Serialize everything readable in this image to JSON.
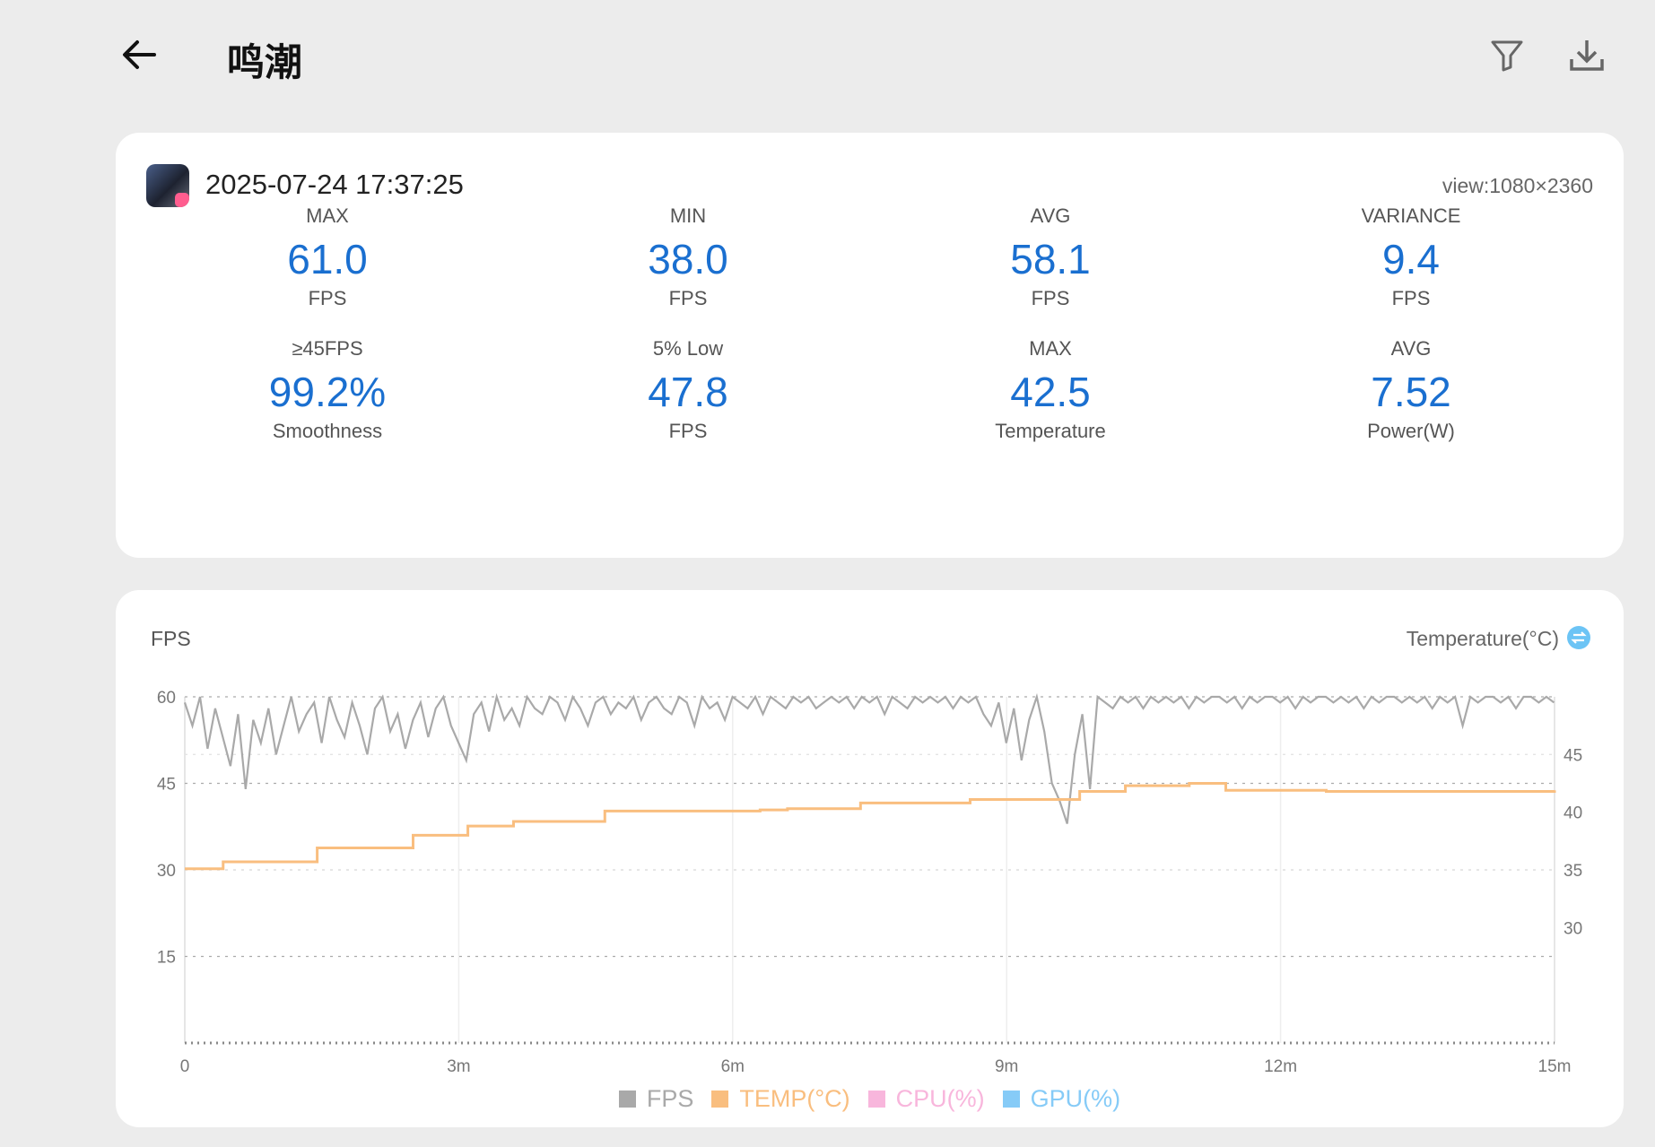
{
  "header": {
    "title": "鸣潮",
    "back_icon": "arrow-left-icon",
    "filter_icon": "filter-icon",
    "download_icon": "download-icon"
  },
  "summary": {
    "datetime": "2025-07-24 17:37:25",
    "view": "view:1080×2360",
    "stats": [
      {
        "label": "MAX",
        "value": "61.0",
        "unit": "FPS"
      },
      {
        "label": "MIN",
        "value": "38.0",
        "unit": "FPS"
      },
      {
        "label": "AVG",
        "value": "58.1",
        "unit": "FPS"
      },
      {
        "label": "VARIANCE",
        "value": "9.4",
        "unit": "FPS"
      },
      {
        "label": "≥45FPS",
        "value": "99.2%",
        "unit": "Smoothness"
      },
      {
        "label": "5% Low",
        "value": "47.8",
        "unit": "FPS"
      },
      {
        "label": "MAX",
        "value": "42.5",
        "unit": "Temperature"
      },
      {
        "label": "AVG",
        "value": "7.52",
        "unit": "Power(W)"
      }
    ],
    "accent": "#1a6fd0"
  },
  "chart_data": {
    "type": "line",
    "left_axis_title": "FPS",
    "right_axis_title": "Temperature(°C)",
    "xlim": [
      0,
      15
    ],
    "x_ticks": [
      {
        "v": 0,
        "label": "0"
      },
      {
        "v": 3,
        "label": "3m"
      },
      {
        "v": 6,
        "label": "6m"
      },
      {
        "v": 9,
        "label": "9m"
      },
      {
        "v": 12,
        "label": "12m"
      },
      {
        "v": 15,
        "label": "15m"
      }
    ],
    "ylim_left": [
      0,
      60
    ],
    "y_ticks_left": [
      {
        "v": 15,
        "label": "15"
      },
      {
        "v": 30,
        "label": "30"
      },
      {
        "v": 45,
        "label": "45"
      },
      {
        "v": 60,
        "label": "60"
      }
    ],
    "ylim_right": [
      20,
      50
    ],
    "y_ticks_right": [
      {
        "v": 30,
        "label": "30"
      },
      {
        "v": 35,
        "label": "35"
      },
      {
        "v": 40,
        "label": "40"
      },
      {
        "v": 45,
        "label": "45"
      }
    ],
    "legend": [
      {
        "name": "FPS",
        "color": "#a9a9a9"
      },
      {
        "name": "TEMP(°C)",
        "color": "#f9be7f"
      },
      {
        "name": "CPU(%)",
        "color": "#f8b6dc"
      },
      {
        "name": "GPU(%)",
        "color": "#86cbf7"
      }
    ],
    "series": [
      {
        "name": "FPS",
        "axis": "left",
        "x_step_min": 0.0833,
        "values": [
          59,
          55,
          60,
          51,
          58,
          53,
          48,
          57,
          44,
          56,
          52,
          58,
          50,
          55,
          60,
          54,
          57,
          59,
          52,
          60,
          56,
          53,
          59,
          55,
          50,
          58,
          60,
          54,
          57,
          51,
          56,
          59,
          53,
          58,
          60,
          55,
          52,
          49,
          57,
          59,
          54,
          60,
          56,
          58,
          55,
          60,
          58,
          57,
          60,
          59,
          56,
          60,
          58,
          55,
          59,
          60,
          57,
          59,
          58,
          60,
          56,
          59,
          60,
          58,
          57,
          60,
          59,
          55,
          60,
          58,
          59,
          56,
          60,
          59,
          58,
          60,
          57,
          60,
          59,
          58,
          60,
          59,
          60,
          58,
          59,
          60,
          59,
          60,
          58,
          60,
          59,
          60,
          57,
          60,
          59,
          58,
          60,
          59,
          60,
          59,
          60,
          58,
          60,
          59,
          60,
          57,
          55,
          59,
          52,
          58,
          49,
          56,
          60,
          54,
          45,
          42,
          38,
          50,
          57,
          44,
          60,
          59,
          58,
          60,
          59,
          60,
          58,
          60,
          59,
          60,
          59,
          60,
          58,
          60,
          59,
          60,
          60,
          59,
          60,
          58,
          60,
          59,
          60,
          60,
          59,
          60,
          58,
          60,
          59,
          60,
          60,
          59,
          60,
          59,
          60,
          58,
          60,
          59,
          60,
          60,
          59,
          60,
          59,
          60,
          58,
          60,
          59,
          60,
          55,
          60,
          59,
          60,
          60,
          59,
          60,
          58,
          60,
          60,
          59,
          60,
          59
        ]
      },
      {
        "name": "TEMP(°C)",
        "axis": "right",
        "steps": [
          [
            0,
            35.1
          ],
          [
            0.42,
            35.7
          ],
          [
            1.45,
            36.9
          ],
          [
            2.5,
            38.0
          ],
          [
            3.1,
            38.8
          ],
          [
            3.6,
            39.2
          ],
          [
            4.6,
            40.1
          ],
          [
            6.3,
            40.2
          ],
          [
            6.6,
            40.3
          ],
          [
            7.4,
            40.8
          ],
          [
            8.6,
            41.1
          ],
          [
            9.8,
            41.8
          ],
          [
            10.3,
            42.3
          ],
          [
            11.0,
            42.5
          ],
          [
            11.4,
            41.9
          ],
          [
            12.5,
            41.8
          ],
          [
            15,
            41.9
          ]
        ]
      }
    ]
  }
}
